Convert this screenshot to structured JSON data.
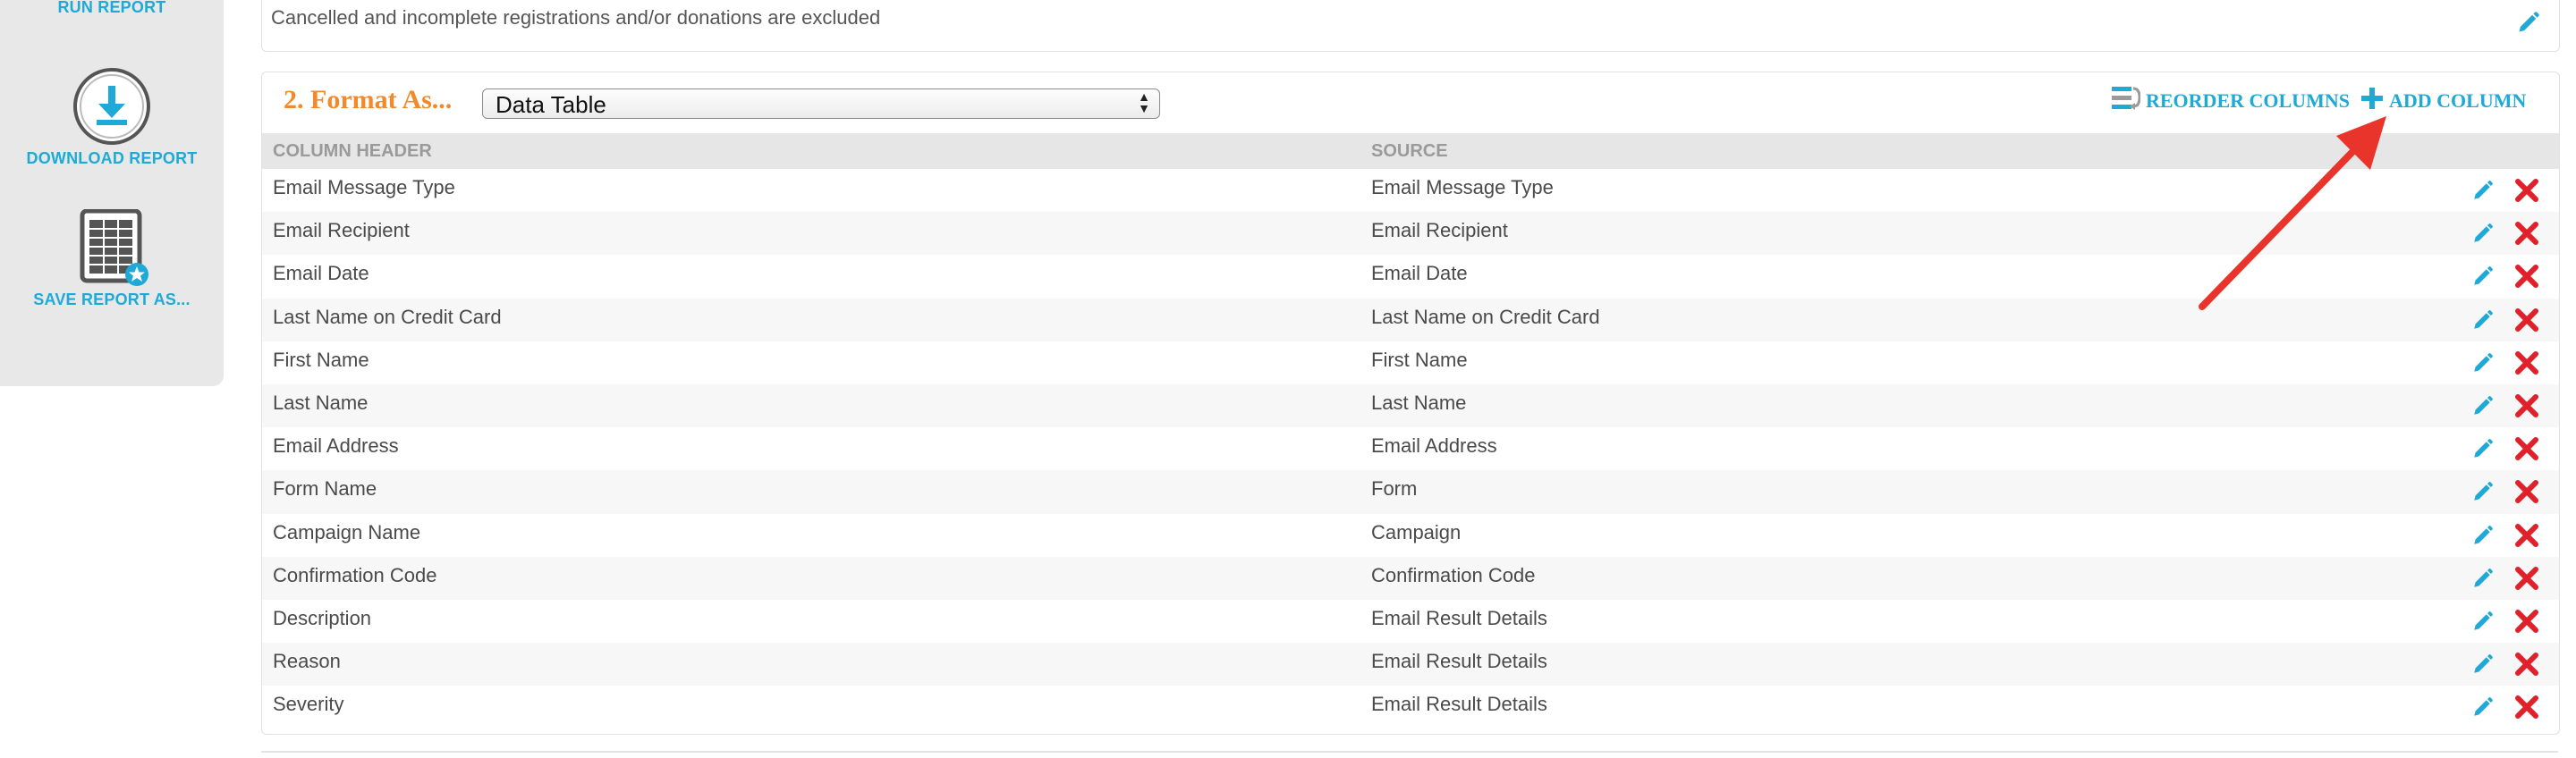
{
  "sidebar": {
    "run_report": "RUN REPORT",
    "download_report": "DOWNLOAD REPORT",
    "save_report_as": "SAVE REPORT AS..."
  },
  "filters": {
    "note": "Cancelled and incomplete registrations and/or donations are excluded"
  },
  "format": {
    "title": "2. Format As...",
    "selected": "Data Table",
    "reorder_label": "REORDER COLUMNS",
    "add_label": "ADD COLUMN",
    "headers": {
      "column_header": "COLUMN HEADER",
      "source": "SOURCE"
    },
    "rows": [
      {
        "header": "Email Message Type",
        "source": "Email Message Type"
      },
      {
        "header": "Email Recipient",
        "source": "Email Recipient"
      },
      {
        "header": "Email Date",
        "source": "Email Date"
      },
      {
        "header": "Last Name on Credit Card",
        "source": "Last Name on Credit Card"
      },
      {
        "header": "First Name",
        "source": "First Name"
      },
      {
        "header": "Last Name",
        "source": "Last Name"
      },
      {
        "header": "Email Address",
        "source": "Email Address"
      },
      {
        "header": "Form Name",
        "source": "Form"
      },
      {
        "header": "Campaign Name",
        "source": "Campaign"
      },
      {
        "header": "Confirmation Code",
        "source": "Confirmation Code"
      },
      {
        "header": "Description",
        "source": "Email Result Details"
      },
      {
        "header": "Reason",
        "source": "Email Result Details"
      },
      {
        "header": "Severity",
        "source": "Email Result Details"
      }
    ]
  },
  "colors": {
    "accent": "#1fa9d6",
    "orange": "#f28a2c",
    "delete": "#e0202a",
    "annotation": "#e8342a"
  }
}
